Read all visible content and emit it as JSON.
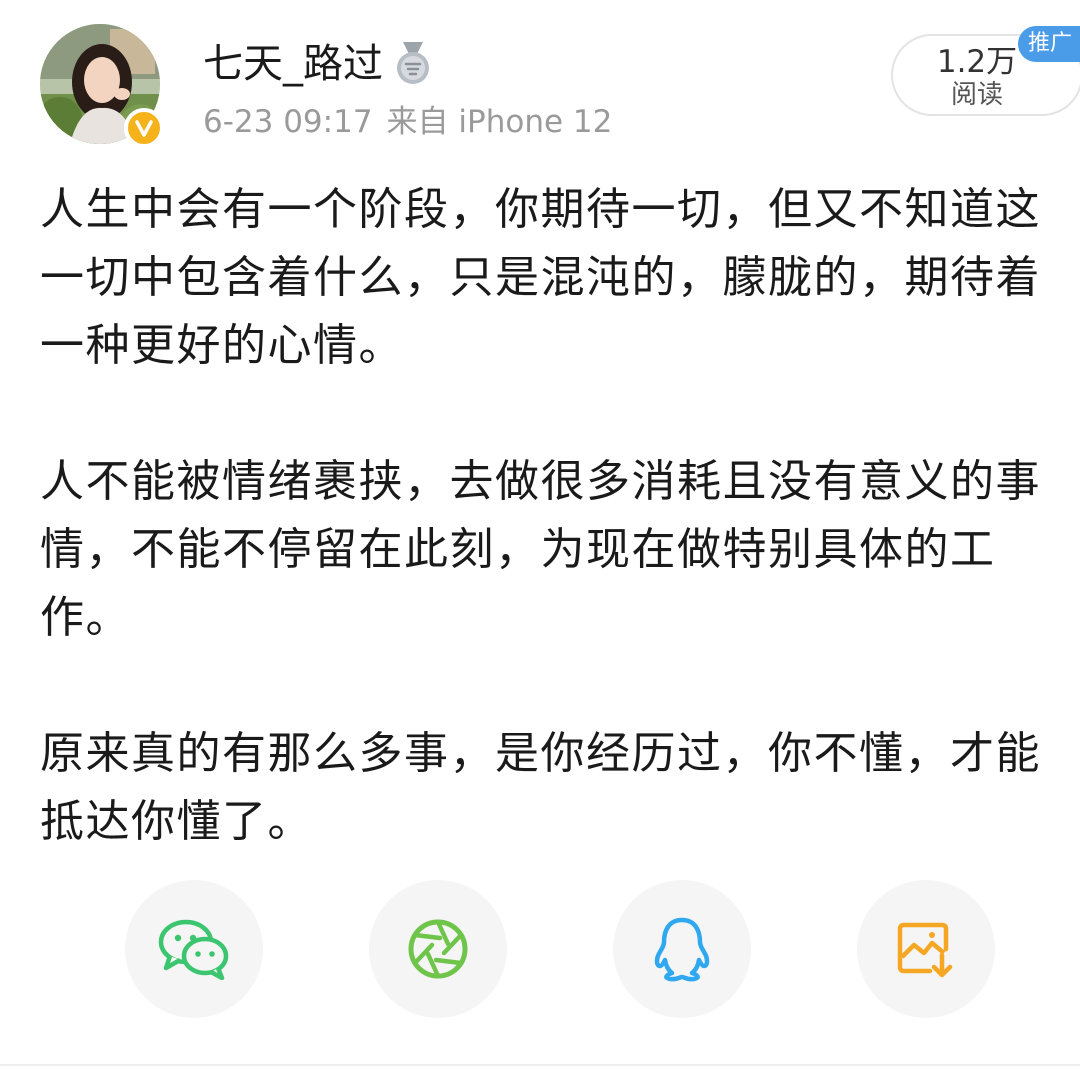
{
  "post": {
    "author": {
      "name": "七天_路过",
      "badge_icon": "medal-icon",
      "verified_icon": "verified-v-icon",
      "verified_color": "#f6b21b"
    },
    "meta": {
      "time": "6-23 09:17",
      "source": "来自 iPhone 12"
    },
    "read_count": "1.2万",
    "read_label": "阅读",
    "promo_tag": "推广",
    "paragraphs": [
      "人生中会有一个阶段，你期待一切，但又不知道这一切中包含着什么，只是混沌的，朦胧的，期待着一种更好的心情。",
      "人不能被情绪裹挟，去做很多消耗且没有意义的事情，不能不停留在此刻，为现在做特别具体的工作。",
      "原来真的有那么多事，是你经历过，你不懂，才能抵达你懂了。"
    ]
  },
  "share": [
    {
      "icon": "wechat-icon",
      "color": "#3cc56f"
    },
    {
      "icon": "moments-icon",
      "color": "#6fc44a"
    },
    {
      "icon": "qq-icon",
      "color": "#2fa8f0"
    },
    {
      "icon": "save-image-icon",
      "color": "#f5a623"
    }
  ]
}
